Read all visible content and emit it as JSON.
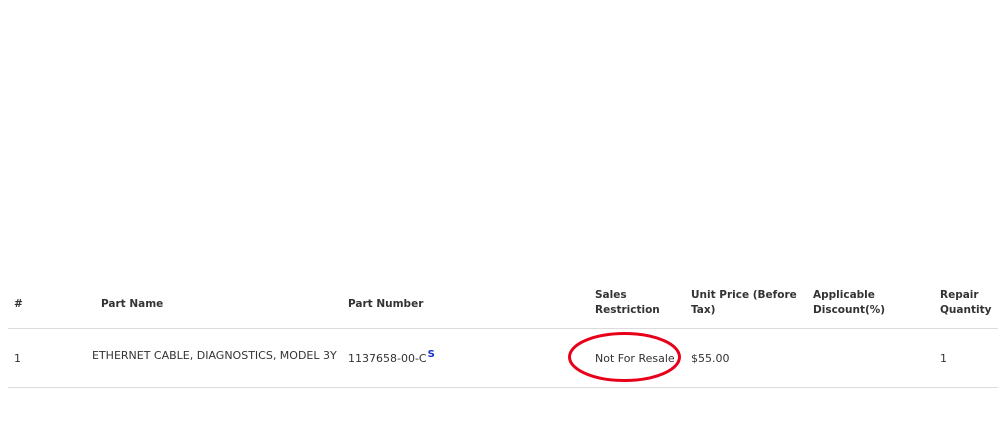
{
  "table": {
    "headers": {
      "index": "#",
      "part_name": "Part Name",
      "part_number": "Part Number",
      "sales_restriction_line1": "Sales",
      "sales_restriction_line2": "Restriction",
      "unit_price_line1": "Unit Price (Before",
      "unit_price_line2": "Tax)",
      "discount_line1": "Applicable",
      "discount_line2": "Discount(%)",
      "repair_qty_line1": "Repair",
      "repair_qty_line2": "Quantity"
    },
    "rows": [
      {
        "index": "1",
        "part_name": "ETHERNET CABLE, DIAGNOSTICS, MODEL 3Y",
        "part_number": "1137658-00-C",
        "part_number_flag": "S",
        "sales_restriction": "Not For Resale",
        "unit_price": "$55.00",
        "discount": "",
        "repair_quantity": "1"
      }
    ]
  },
  "colors": {
    "annotation": "#e8001a",
    "link": "#1a33cc",
    "border": "#dcdcdc",
    "text": "#333333"
  }
}
